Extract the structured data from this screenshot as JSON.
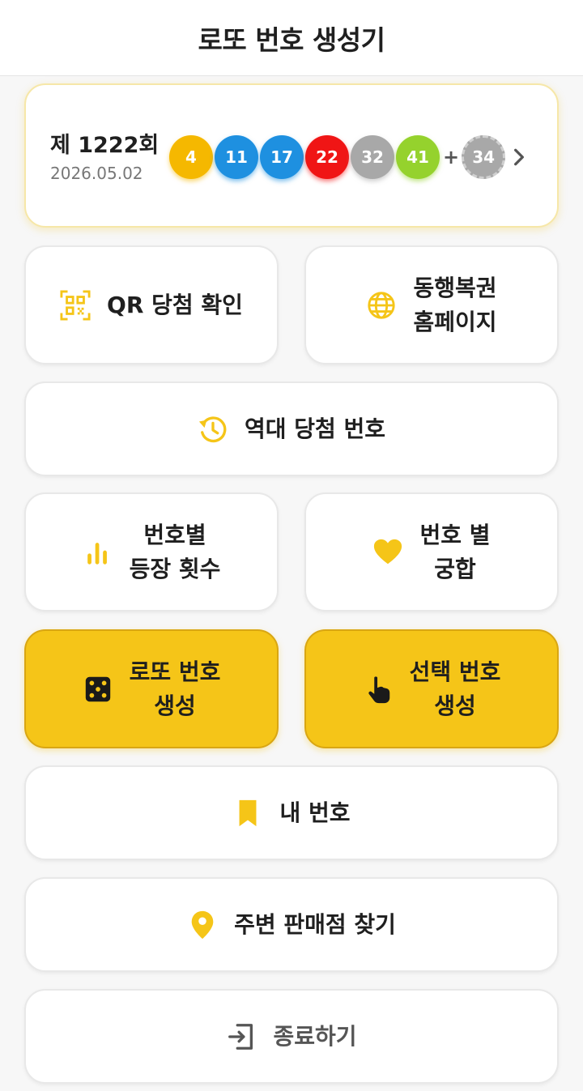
{
  "app_title": "로또 번호 생성기",
  "latest_draw": {
    "round": "제 1222회",
    "date": "2026.05.02",
    "numbers": [
      {
        "value": "4",
        "color": "#f5b800"
      },
      {
        "value": "11",
        "color": "#1e90e0"
      },
      {
        "value": "17",
        "color": "#1e90e0"
      },
      {
        "value": "22",
        "color": "#f01515"
      },
      {
        "value": "32",
        "color": "#a8a8a8"
      },
      {
        "value": "41",
        "color": "#95d22d"
      }
    ],
    "plus": "+",
    "bonus": {
      "value": "34",
      "color": "#a8a8a8"
    }
  },
  "menu": {
    "qr_check": "QR 당첨 확인",
    "dh_homepage": "동행복권\n홈페이지",
    "past_numbers": "역대 당첨 번호",
    "frequency": "번호별\n등장 횟수",
    "compatibility": "번호 별\n궁합",
    "generate": "로또 번호\n생성",
    "select_generate": "선택 번호\n생성",
    "my_numbers": "내 번호",
    "find_store": "주변 판매점 찾기",
    "exit": "종료하기"
  },
  "icons": {
    "qr": "qr-scan-icon",
    "globe": "globe-icon",
    "history": "history-icon",
    "chart": "bar-chart-icon",
    "heart": "heart-icon",
    "dice": "dice-icon",
    "hand": "touch-hand-icon",
    "bookmark": "bookmark-icon",
    "pin": "location-pin-icon",
    "exit": "exit-icon"
  },
  "colors": {
    "accent": "#f5c518",
    "accent_border": "#d9a613",
    "icon_yellow": "#f5c518"
  }
}
